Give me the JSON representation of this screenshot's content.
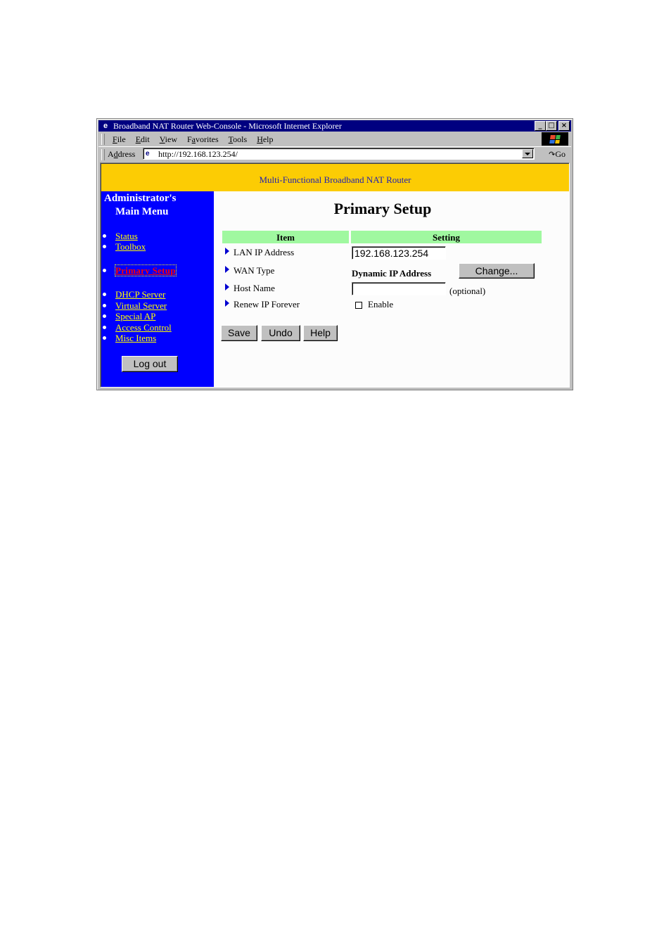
{
  "window": {
    "title": "Broadband NAT Router Web-Console - Microsoft Internet Explorer",
    "controls": {
      "minimize": "_",
      "maximize": "□",
      "close": "×"
    }
  },
  "menubar": {
    "items": [
      {
        "label": "File",
        "accel": "F"
      },
      {
        "label": "Edit",
        "accel": "E"
      },
      {
        "label": "View",
        "accel": "V"
      },
      {
        "label": "Favorites",
        "accel": "a"
      },
      {
        "label": "Tools",
        "accel": "T"
      },
      {
        "label": "Help",
        "accel": "H"
      }
    ]
  },
  "addressbar": {
    "label": "Address",
    "url": "http://192.168.123.254/",
    "go_label": "Go",
    "go_arrow": "↷"
  },
  "banner": {
    "text": "Multi-Functional Broadband NAT Router"
  },
  "sidebar": {
    "title_line1": "Administrator's",
    "title_line2": "Main Menu",
    "links": [
      {
        "label": "Status",
        "active": false
      },
      {
        "label": "Toolbox",
        "active": false
      },
      {
        "label": "Primary Setup",
        "active": true
      },
      {
        "label": "DHCP Server",
        "active": false
      },
      {
        "label": "Virtual Server",
        "active": false
      },
      {
        "label": "Special AP",
        "active": false
      },
      {
        "label": "Access Control",
        "active": false
      },
      {
        "label": "Misc Items",
        "active": false
      }
    ],
    "logout_label": "Log out"
  },
  "main": {
    "title": "Primary Setup",
    "table_headers": {
      "item": "Item",
      "setting": "Setting"
    },
    "rows": {
      "lan_ip": {
        "label": "LAN IP Address",
        "value": "192.168.123.254"
      },
      "wan_type": {
        "label": "WAN Type",
        "value": "Dynamic IP Address",
        "button": "Change..."
      },
      "host_name": {
        "label": "Host Name",
        "value": "",
        "hint": "(optional)"
      },
      "renew_ip": {
        "label": "Renew IP Forever",
        "checkbox_label": "Enable",
        "checked": false
      }
    },
    "buttons": {
      "save": "Save",
      "undo": "Undo",
      "help": "Help"
    }
  },
  "colors": {
    "banner_bg": "#fccc04",
    "banner_text": "#2323b0",
    "sidebar_bg": "#0000ff",
    "link": "#ffff00",
    "active_link": "#ff0000",
    "header_bg": "#a0f8a0",
    "titlebar": "#000080"
  }
}
